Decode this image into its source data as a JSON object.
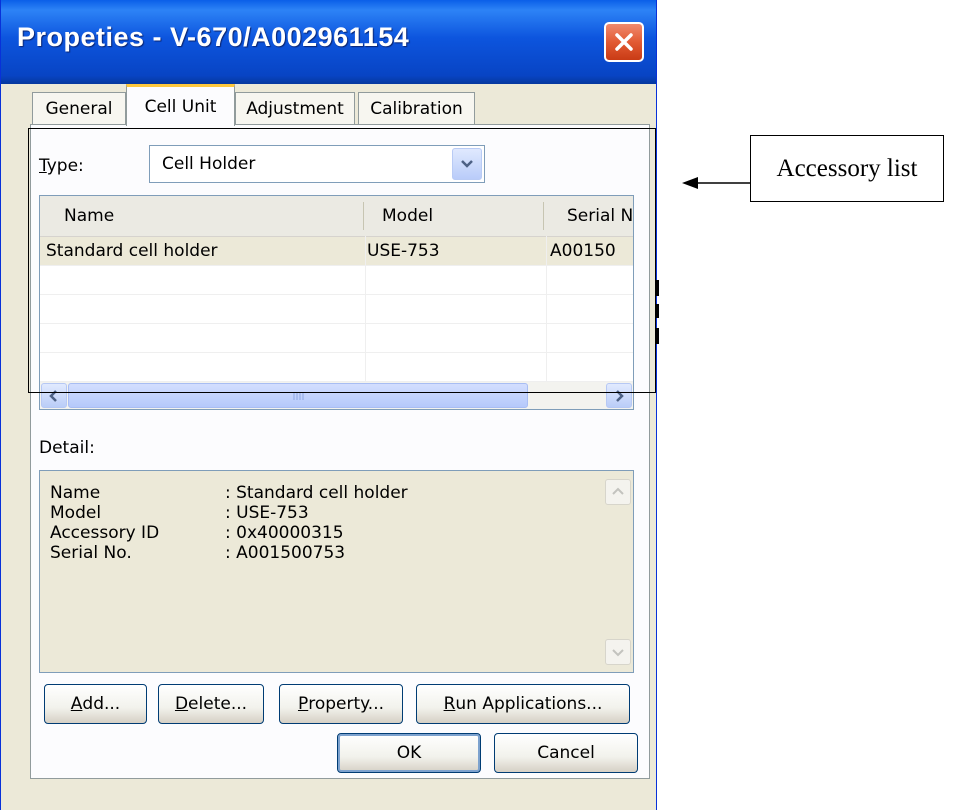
{
  "window": {
    "title": "Propeties - V-670/A002961154",
    "close_icon": "close-icon"
  },
  "tabs": [
    {
      "label": "General",
      "active": false
    },
    {
      "label": "Cell Unit",
      "active": true
    },
    {
      "label": "Adjustment",
      "active": false
    },
    {
      "label": "Calibration",
      "active": false
    }
  ],
  "type_row": {
    "label_hotkey": "T",
    "label_rest": "ype:",
    "selected": "Cell Holder"
  },
  "accessory_list": {
    "columns": [
      "Name",
      "Model",
      "Serial N"
    ],
    "rows": [
      {
        "name": "Standard cell holder",
        "model": "USE-753",
        "serial": "A00150"
      }
    ]
  },
  "detail": {
    "label": "Detail:",
    "fields": [
      {
        "key": "Name",
        "value": ": Standard cell holder"
      },
      {
        "key": "Model",
        "value": ": USE-753"
      },
      {
        "key": "Accessory ID",
        "value": ": 0x40000315"
      },
      {
        "key": "Serial No.",
        "value": ": A001500753"
      }
    ]
  },
  "buttons": {
    "add": {
      "hotkey": "A",
      "rest": "dd..."
    },
    "delete": {
      "hotkey": "D",
      "rest": "elete..."
    },
    "property": {
      "hotkey": "P",
      "rest": "roperty..."
    },
    "run": {
      "hotkey": "R",
      "rest": "un Applications..."
    },
    "ok": "OK",
    "cancel": "Cancel"
  },
  "annotation": {
    "label": "Accessory list"
  },
  "colors": {
    "title_bar": "#0A5FE8",
    "face": "#ECE9D8",
    "active_tab_accent": "#FFC83C",
    "close": "#E25A33"
  }
}
